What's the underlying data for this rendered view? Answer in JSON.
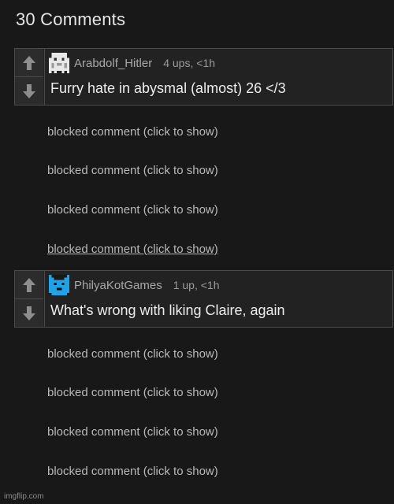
{
  "header": {
    "title": "30 Comments"
  },
  "comments": [
    {
      "username": "Arabdolf_Hitler",
      "meta": "4 ups, <1h",
      "text": "Furry hate in abysmal (almost) 26 </3",
      "avatar_icon": "white-pixel-face-icon"
    },
    {
      "username": "PhilyaKotGames",
      "meta": "1 up, <1h",
      "text": "What's wrong with liking Claire, again",
      "avatar_icon": "blue-pixel-cat-icon"
    }
  ],
  "blocked": {
    "label": "blocked comment (click to show)"
  },
  "footer": {
    "watermark": "imgflip.com"
  },
  "colors": {
    "background": "#181818",
    "panel": "#222222",
    "border": "#4a4a4a",
    "avatar_blue": "#1fa3e8"
  }
}
